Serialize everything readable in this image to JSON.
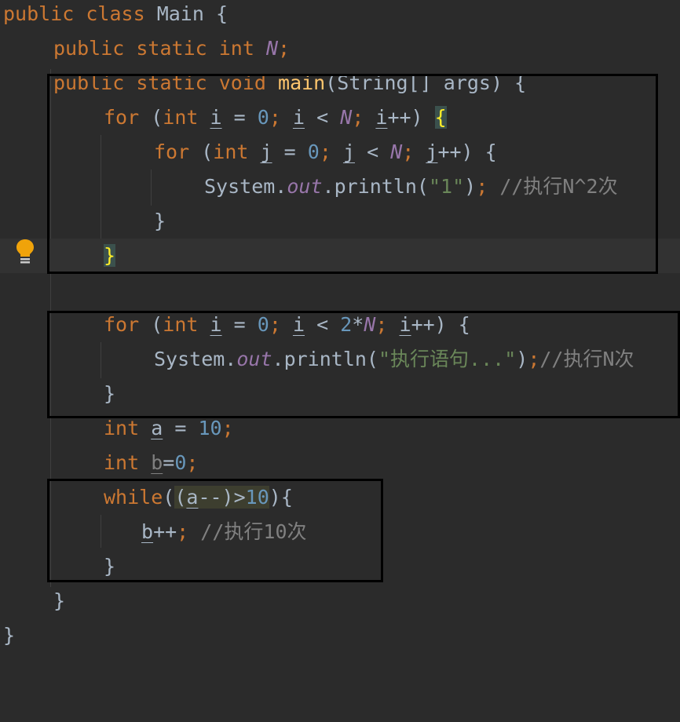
{
  "code": {
    "class_decl": {
      "kw_public": "public",
      "kw_class": "class",
      "name": "Main",
      "brace": "{"
    },
    "field_decl": {
      "kw_public": "public",
      "kw_static": "static",
      "kw_int": "int",
      "name": "N",
      "semi": ";"
    },
    "main_decl": {
      "kw_public": "public",
      "kw_static": "static",
      "kw_void": "void",
      "name": "main",
      "params": "(String[] args) {"
    },
    "loop1": {
      "kw_for": "for",
      "open": "(",
      "kw_int": "int",
      "var": "i",
      "assign": "=",
      "zero": "0",
      "semi": ";",
      "cond_var": "i",
      "lt": "<",
      "bound": "N",
      "semi2": ";",
      "inc_var": "i",
      "inc": "++)",
      "brace": "{"
    },
    "loop2": {
      "kw_for": "for",
      "open": "(",
      "kw_int": "int",
      "var": "j",
      "assign": "=",
      "zero": "0",
      "semi": ";",
      "cond_var": "j",
      "lt": "<",
      "bound": "N",
      "semi2": ";",
      "inc_var": "j",
      "inc": "++)",
      "brace": "{"
    },
    "print1": {
      "obj": "System.",
      "field": "out",
      "call": ".println(",
      "str": "\"1\"",
      "close": ")",
      "semi": ";",
      "comment": "//执行N^2次"
    },
    "close_inner": "}",
    "close_outer": "}",
    "loop3": {
      "kw_for": "for",
      "open": "(",
      "kw_int": "int",
      "var": "i",
      "assign": "=",
      "zero": "0",
      "semi": ";",
      "cond_var": "i",
      "lt": "<",
      "two": "2",
      "mul": "*",
      "bound": "N",
      "semi2": ";",
      "inc_var": "i",
      "inc": "++)",
      "brace": "{"
    },
    "print2": {
      "obj": "System.",
      "field": "out",
      "call": ".println(",
      "str": "\"执行语句...\"",
      "close": ")",
      "semi": ";",
      "comment": "//执行N次"
    },
    "close_loop3": "}",
    "decl_a": {
      "kw_int": "int",
      "var": "a",
      "assign": "=",
      "val": "10",
      "semi": ";"
    },
    "decl_b": {
      "kw_int": "int",
      "var": "b",
      "assign": "=",
      "val": "0",
      "semi": ";"
    },
    "while_loop": {
      "kw_while": "while",
      "open": "(",
      "cond_open": "(",
      "var": "a",
      "dec": "--)",
      "gt": ">",
      "val": "10",
      "close": "){"
    },
    "body_b": {
      "var": "b",
      "inc": "++",
      "semi": ";",
      "comment": "//执行10次"
    },
    "close_while": "}",
    "close_main": "}",
    "close_class": "}"
  },
  "colors": {
    "background": "#2b2b2b",
    "keyword": "#cc7832",
    "number": "#6897bb",
    "string": "#6a8759",
    "comment": "#808080",
    "field": "#9876aa",
    "method": "#ffc66d",
    "text": "#a9b7c6",
    "brace_highlight": "#ffef28",
    "annotation_box": "#000000"
  },
  "gutter": {
    "icon": "lightbulb-icon"
  }
}
